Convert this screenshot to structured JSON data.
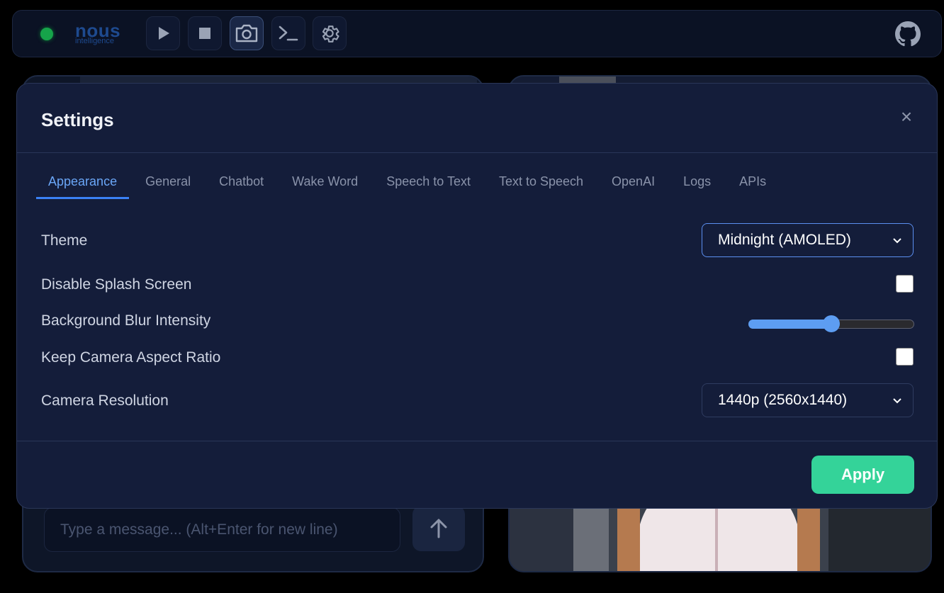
{
  "app": {
    "logo_text": "nous",
    "logo_subtext": "intelligence",
    "status_color": "#16a34a"
  },
  "toolbar": {
    "buttons": [
      {
        "name": "play-button",
        "icon": "play-icon"
      },
      {
        "name": "stop-button",
        "icon": "stop-icon"
      },
      {
        "name": "camera-button",
        "icon": "camera-icon",
        "active": true
      },
      {
        "name": "terminal-button",
        "icon": "terminal-icon"
      },
      {
        "name": "settings-button",
        "icon": "gear-icon"
      }
    ],
    "github_icon": "github-icon"
  },
  "chat": {
    "input_placeholder": "Type a message... (Alt+Enter for new line)",
    "send_icon": "arrow-up-icon"
  },
  "settings": {
    "title": "Settings",
    "close_glyph": "×",
    "tabs": [
      {
        "label": "Appearance",
        "active": true
      },
      {
        "label": "General"
      },
      {
        "label": "Chatbot"
      },
      {
        "label": "Wake Word"
      },
      {
        "label": "Speech to Text"
      },
      {
        "label": "Text to Speech"
      },
      {
        "label": "OpenAI"
      },
      {
        "label": "Logs"
      },
      {
        "label": "APIs"
      }
    ],
    "fields": {
      "theme": {
        "label": "Theme",
        "value": "Midnight (AMOLED)"
      },
      "disable_splash": {
        "label": "Disable Splash Screen",
        "checked": false
      },
      "blur": {
        "label": "Background Blur Intensity",
        "value_fraction": 0.5
      },
      "keep_aspect": {
        "label": "Keep Camera Aspect Ratio",
        "checked": false
      },
      "resolution": {
        "label": "Camera Resolution",
        "value": "1440p (2560x1440)"
      }
    },
    "apply_label": "Apply",
    "accent_color": "#3b82f6",
    "apply_color": "#34d399"
  }
}
